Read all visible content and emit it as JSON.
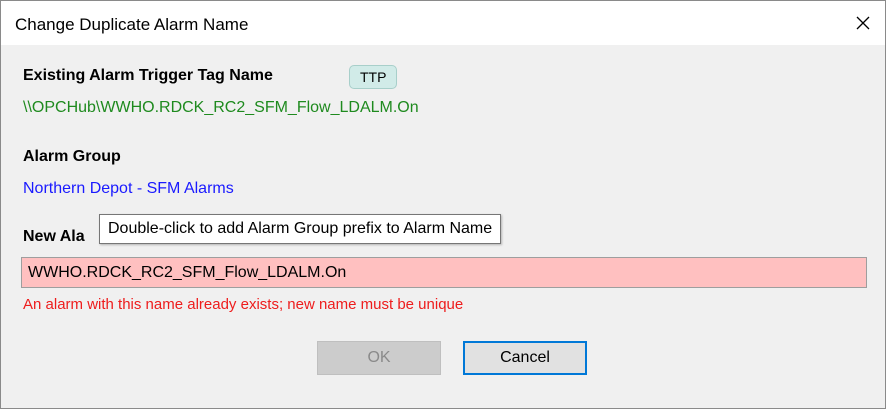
{
  "window": {
    "title": "Change Duplicate Alarm Name",
    "close_icon": "close-icon"
  },
  "existing": {
    "label": "Existing Alarm Trigger Tag Name",
    "badge": "TTP",
    "value": "\\\\OPCHub\\WWHO.RDCK_RC2_SFM_Flow_LDALM.On"
  },
  "group": {
    "label": "Alarm Group",
    "value": "Northern Depot - SFM Alarms"
  },
  "new_name": {
    "label_visible": "New Ala",
    "tooltip": "Double-click to add Alarm Group prefix to Alarm Name",
    "value": "WWHO.RDCK_RC2_SFM_Flow_LDALM.On",
    "error": "An alarm with this name already exists; new name must be unique"
  },
  "buttons": {
    "ok_label": "OK",
    "cancel_label": "Cancel"
  },
  "colors": {
    "tag_path": "#1e8a1e",
    "group_value": "#1a1aff",
    "error_text": "#ee1c1c",
    "input_error_bg": "#ffc0c0",
    "badge_bg": "#d1ebe8",
    "focus_border": "#0078d7"
  }
}
